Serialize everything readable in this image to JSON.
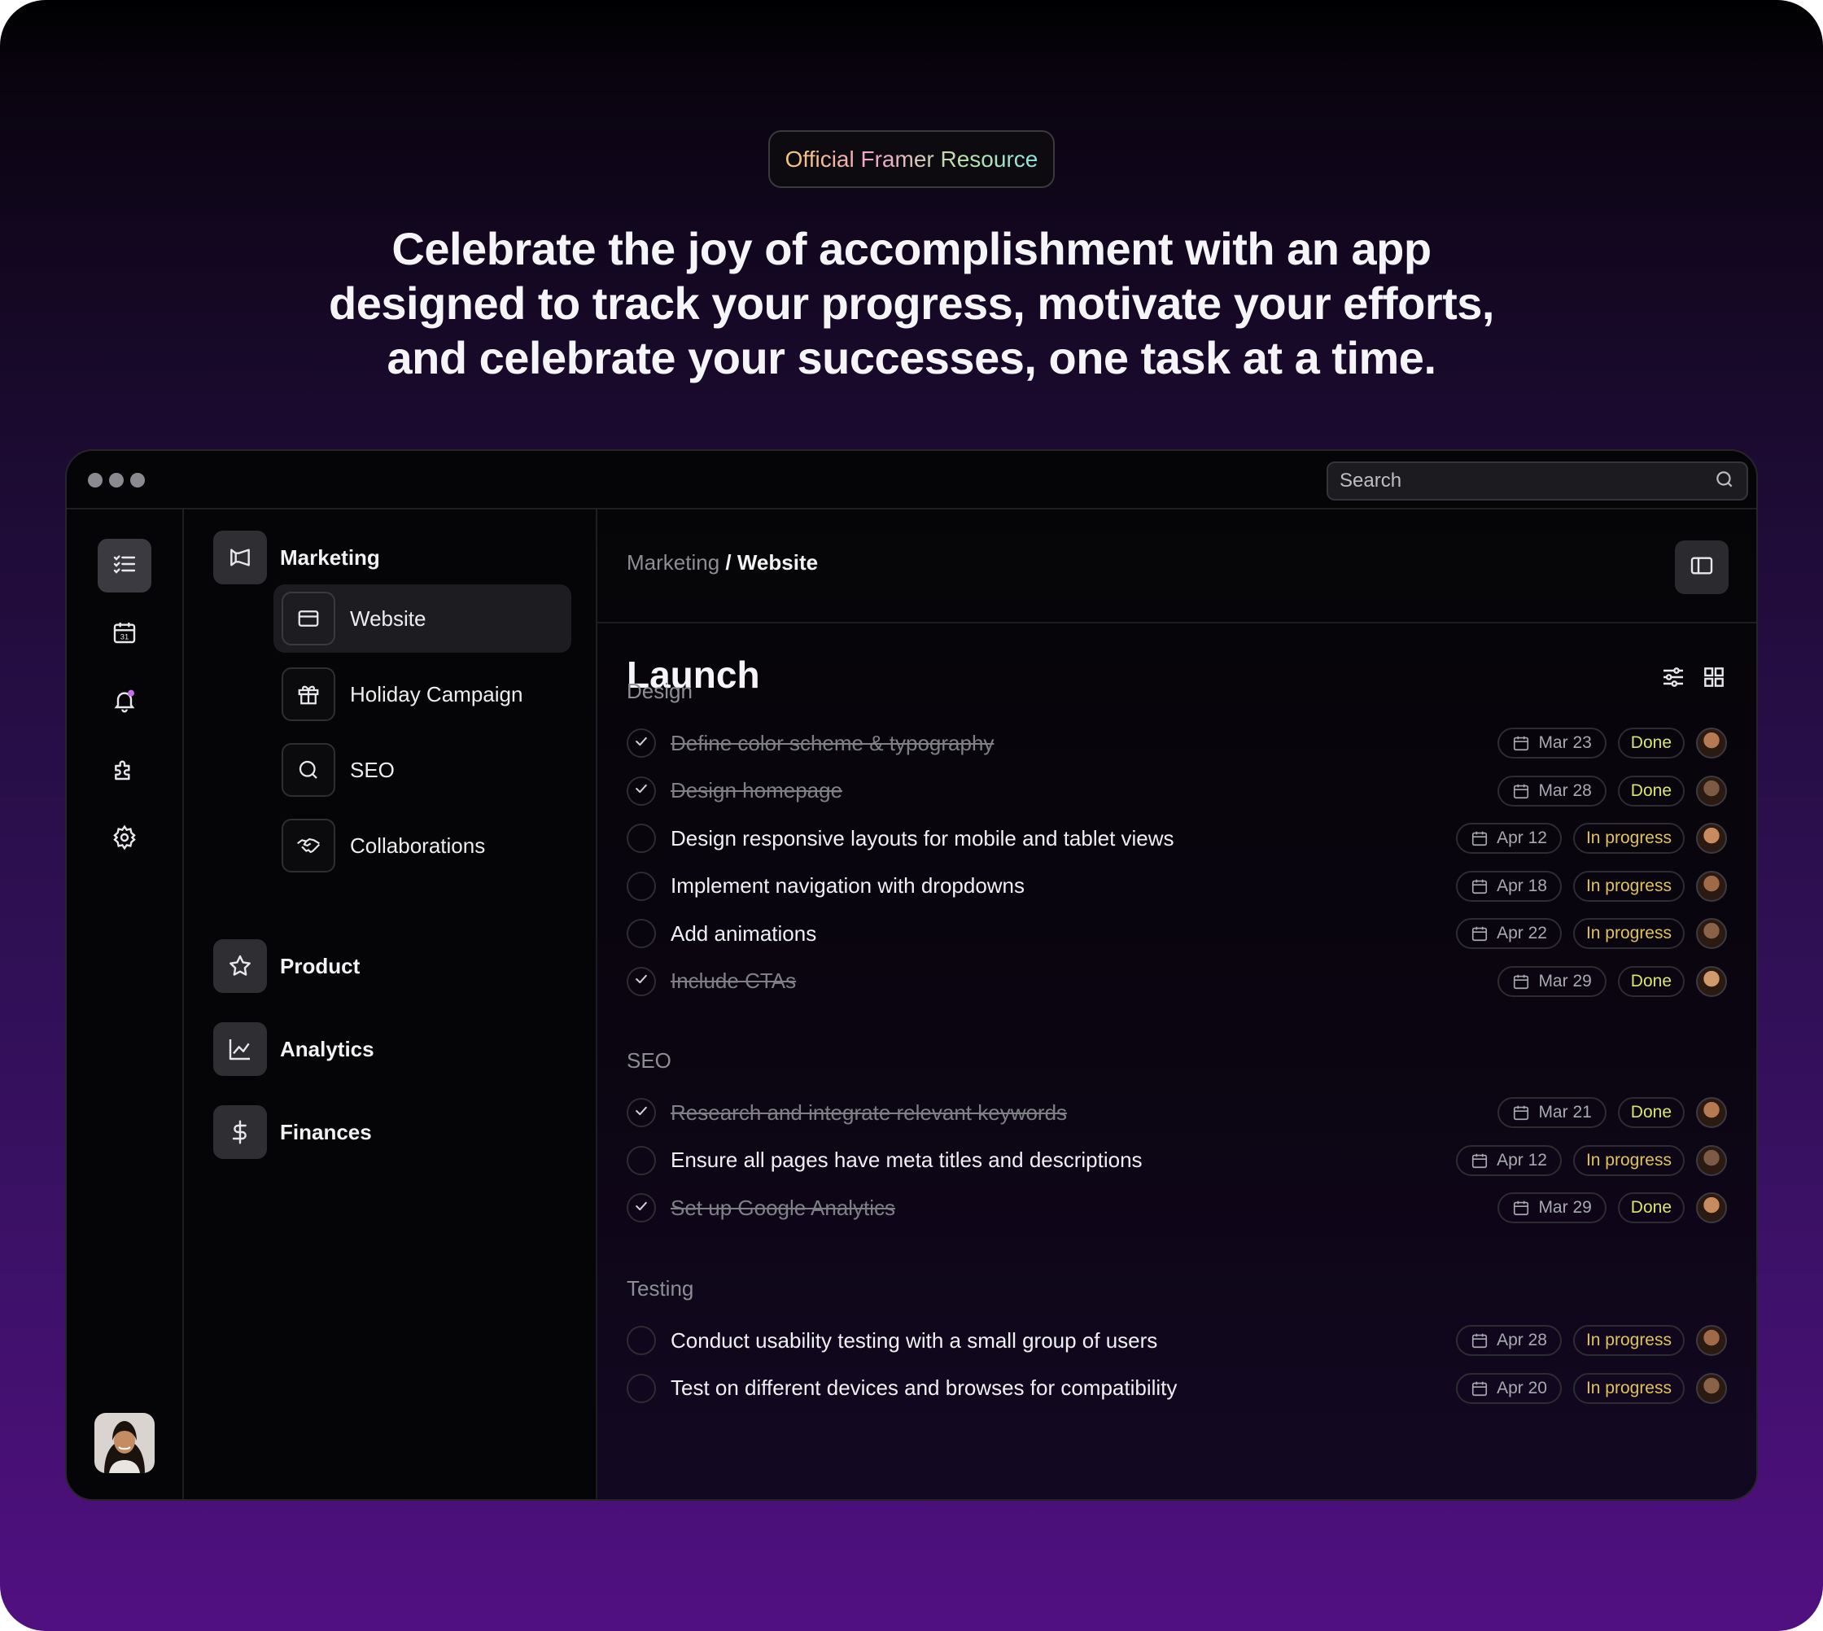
{
  "badge": "Official Framer Resource",
  "headline": {
    "line1": "Celebrate the joy of accomplishment with an app",
    "line2": "designed to track your progress, motivate your efforts,",
    "line3": "and celebrate your successes, one task at a time."
  },
  "search": {
    "placeholder": "Search",
    "icon": "search-icon"
  },
  "rail": {
    "items": [
      {
        "icon": "checklist-icon",
        "active": true
      },
      {
        "icon": "calendar-icon",
        "calendar_day": "31"
      },
      {
        "icon": "bell-icon",
        "notification_dot_color": "#c86cf0"
      },
      {
        "icon": "puzzle-icon"
      },
      {
        "icon": "gear-icon"
      }
    ]
  },
  "nav": {
    "marketing": "Marketing",
    "sub": [
      "Website",
      "Holiday Campaign",
      "SEO",
      "Collaborations"
    ],
    "product": "Product",
    "analytics": "Analytics",
    "finances": "Finances"
  },
  "breadcrumb": {
    "parent": "Marketing",
    "sep": "/",
    "current": "Website"
  },
  "page_title": "Launch",
  "colors": {
    "done": "#d9e86b",
    "in_progress": "#e2c35a",
    "accent_dot": "#c86cf0"
  },
  "sections": [
    {
      "title": "Design",
      "tasks": [
        {
          "title": "Define color scheme & typography",
          "date": "Mar 23",
          "status": "Done",
          "done": true
        },
        {
          "title": "Design homepage",
          "date": "Mar 28",
          "status": "Done",
          "done": true
        },
        {
          "title": "Design responsive layouts for mobile and tablet views",
          "date": "Apr 12",
          "status": "In progress",
          "done": false
        },
        {
          "title": "Implement navigation with dropdowns",
          "date": "Apr 18",
          "status": "In progress",
          "done": false
        },
        {
          "title": "Add animations",
          "date": "Apr 22",
          "status": "In progress",
          "done": false
        },
        {
          "title": "Include CTAs",
          "date": "Mar 29",
          "status": "Done",
          "done": true
        }
      ]
    },
    {
      "title": "SEO",
      "tasks": [
        {
          "title": "Research and integrate relevant keywords",
          "date": "Mar 21",
          "status": "Done",
          "done": true
        },
        {
          "title": "Ensure all pages have meta titles and descriptions",
          "date": "Apr 12",
          "status": "In progress",
          "done": false
        },
        {
          "title": "Set up Google Analytics",
          "date": "Mar 29",
          "status": "Done",
          "done": true
        }
      ]
    },
    {
      "title": "Testing",
      "tasks": [
        {
          "title": "Conduct usability testing with a small group of users",
          "date": "Apr 28",
          "status": "In progress",
          "done": false
        },
        {
          "title": "Test on different devices and browses for compatibility",
          "date": "Apr 20",
          "status": "In progress",
          "done": false
        }
      ]
    }
  ]
}
